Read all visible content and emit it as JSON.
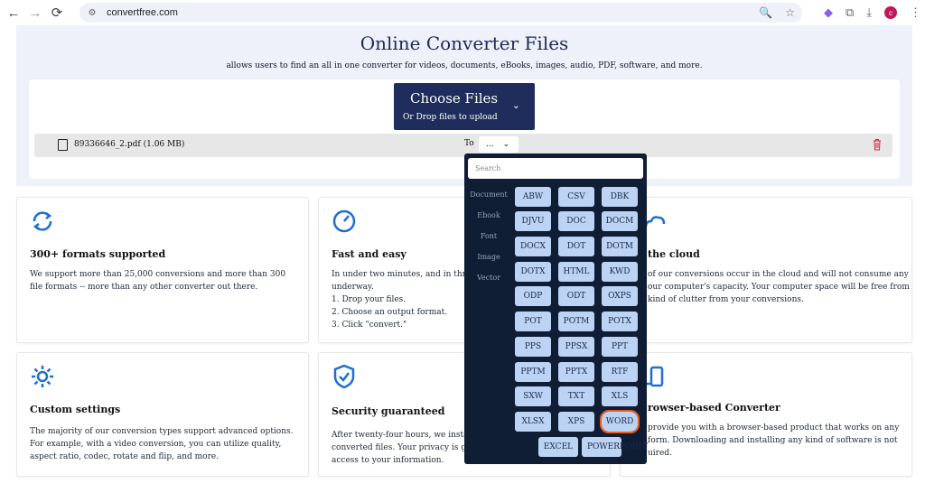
{
  "browser": {
    "url": "convertfree.com",
    "profile_initial": "c"
  },
  "hero": {
    "title": "Online Converter Files",
    "subtitle": "allows users to find an all in one converter for videos, documents, eBooks, images, audio, PDF, software, and more.",
    "choose_label": "Choose Files",
    "choose_sub": "Or Drop files to upload"
  },
  "file": {
    "name": "89336646_2.pdf (1.06 MB)",
    "to_label": "To",
    "selected": "..."
  },
  "cards": [
    {
      "title": "300+ formats supported",
      "body": "We support more than 25,000 conversions and more than 300 file formats -- more than any other converter out there."
    },
    {
      "title": "Fast and easy",
      "body": "In under two minutes, and in three\nunderway.\n1. Drop your files.\n2. Choose an output format.\n3. Click \"convert.\""
    },
    {
      "title": "the cloud",
      "body": "of our conversions occur in the cloud and will not consume any\nour computer's capacity. Your computer space will be free from\nkind of clutter from your conversions."
    },
    {
      "title": "Custom settings",
      "body": "The majority of our conversion types support advanced options. For example, with a video conversion, you can utilize quality, aspect ratio, codec, rotate and flip, and more."
    },
    {
      "title": "Security guaranteed",
      "body": "After twenty-four hours, we instar\nconverted files. Your privacy is gu\naccess to your information."
    },
    {
      "title": "rowser-based Converter",
      "body": "provide you with a browser-based product that works on any\nform. Downloading and installing any kind of software is not\nuired."
    }
  ],
  "dropdown": {
    "search_placeholder": "Search",
    "categories": [
      "Document",
      "Ebook",
      "Font",
      "Image",
      "Vector"
    ],
    "formats": [
      "ABW",
      "CSV",
      "DBK",
      "DJVU",
      "DOC",
      "DOCM",
      "DOCX",
      "DOT",
      "DOTM",
      "DOTX",
      "HTML",
      "KWD",
      "ODP",
      "ODT",
      "OXPS",
      "POT",
      "POTM",
      "POTX",
      "PPS",
      "PPSX",
      "PPT",
      "PPTM",
      "PPTX",
      "RTF",
      "SXW",
      "TXT",
      "XLS",
      "XLSX",
      "XPS",
      "WORD",
      "EXCEL",
      "POWERPOINT"
    ],
    "highlighted": "WORD"
  }
}
